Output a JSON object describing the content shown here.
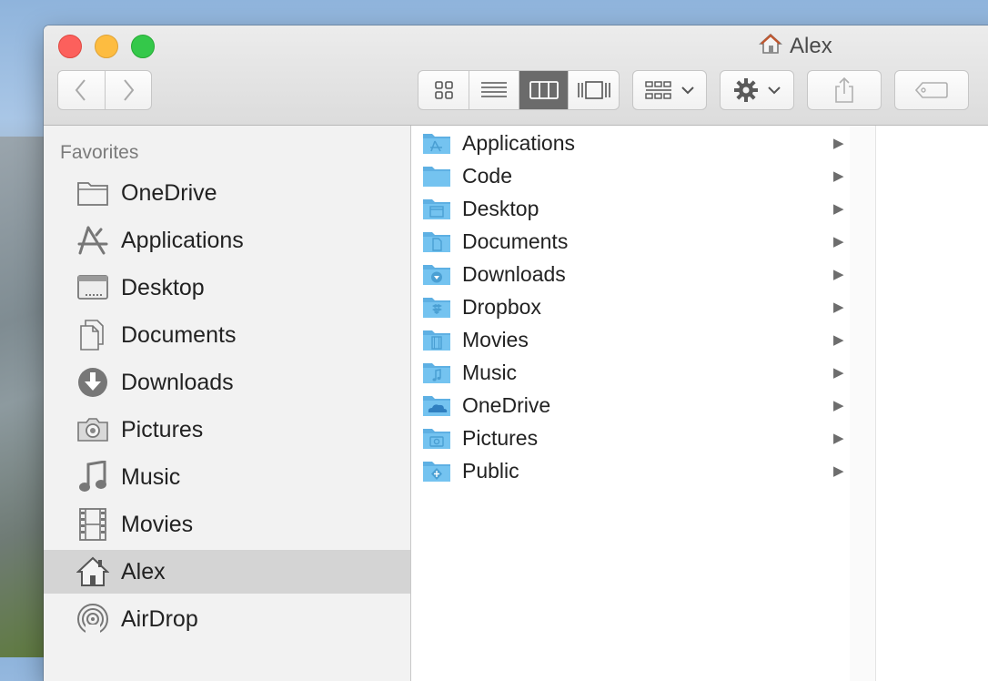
{
  "window": {
    "title": "Alex",
    "title_icon": "home-icon"
  },
  "toolbar": {
    "back_icon": "chevron-left-icon",
    "forward_icon": "chevron-right-icon",
    "view_modes": [
      "icon-view-icon",
      "list-view-icon",
      "column-view-icon",
      "cover-flow-icon"
    ],
    "active_view": "column-view-icon",
    "group_icon": "arrange-icon",
    "action_icon": "gear-icon",
    "share_icon": "share-icon",
    "tag_icon": "tag-icon"
  },
  "sidebar": {
    "section_title": "Favorites",
    "items": [
      {
        "label": "OneDrive",
        "icon": "folder-icon"
      },
      {
        "label": "Applications",
        "icon": "applications-icon"
      },
      {
        "label": "Desktop",
        "icon": "desktop-icon"
      },
      {
        "label": "Documents",
        "icon": "documents-icon"
      },
      {
        "label": "Downloads",
        "icon": "downloads-icon"
      },
      {
        "label": "Pictures",
        "icon": "camera-icon"
      },
      {
        "label": "Music",
        "icon": "music-note-icon"
      },
      {
        "label": "Movies",
        "icon": "film-icon"
      },
      {
        "label": "Alex",
        "icon": "home-icon",
        "selected": true
      },
      {
        "label": "AirDrop",
        "icon": "airdrop-icon"
      }
    ]
  },
  "column1": {
    "items": [
      {
        "label": "Applications",
        "icon": "applications-folder-icon"
      },
      {
        "label": "Code",
        "icon": "folder-icon"
      },
      {
        "label": "Desktop",
        "icon": "desktop-folder-icon"
      },
      {
        "label": "Documents",
        "icon": "documents-folder-icon"
      },
      {
        "label": "Downloads",
        "icon": "downloads-folder-icon"
      },
      {
        "label": "Dropbox",
        "icon": "dropbox-folder-icon"
      },
      {
        "label": "Movies",
        "icon": "movies-folder-icon"
      },
      {
        "label": "Music",
        "icon": "music-folder-icon"
      },
      {
        "label": "OneDrive",
        "icon": "onedrive-folder-icon"
      },
      {
        "label": "Pictures",
        "icon": "pictures-folder-icon"
      },
      {
        "label": "Public",
        "icon": "public-folder-icon"
      }
    ]
  },
  "colors": {
    "folder": "#74c3f0",
    "folder_dark": "#5eb0e3",
    "selection": "#d4d4d4"
  }
}
